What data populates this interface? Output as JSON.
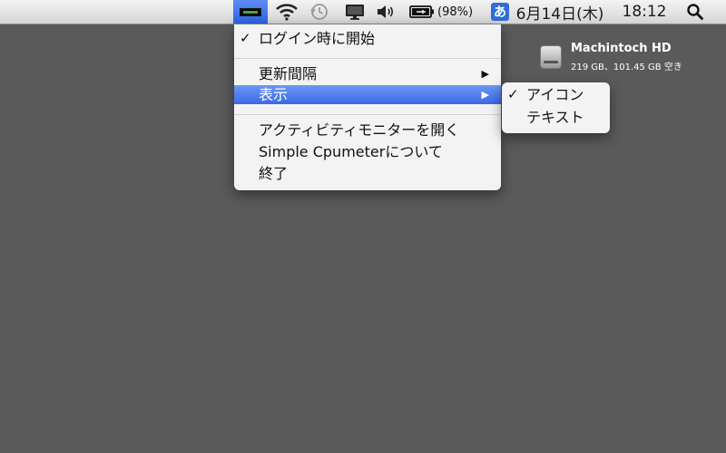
{
  "menubar": {
    "battery_percent": "(98%)",
    "ime_label": "あ",
    "date": "6月14日(木)",
    "time": "18:12"
  },
  "menu": {
    "login_item": "ログイン時に開始",
    "login_checked": "✓",
    "update_interval": "更新間隔",
    "display": "表示",
    "activity_monitor": "アクティビティモニターを開く",
    "about": "Simple Cpumeterについて",
    "quit": "終了",
    "submenu_arrow": "▶"
  },
  "submenu": {
    "icon_option": "アイコン",
    "icon_checked": "✓",
    "text_option": "テキスト"
  },
  "desktop": {
    "drive_name": "Machintoch HD",
    "drive_info": "219 GB、101.45 GB 空き"
  }
}
